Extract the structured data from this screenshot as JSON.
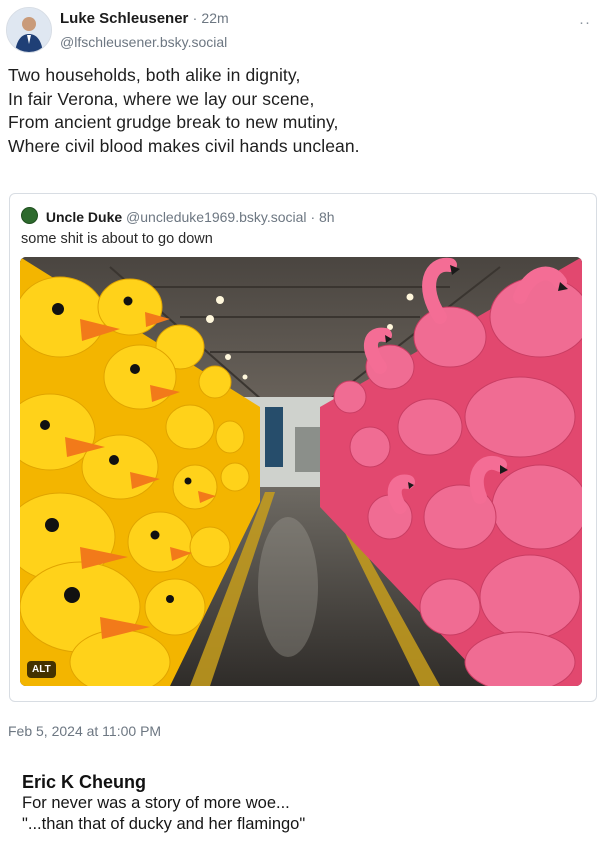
{
  "post": {
    "author_name": "Luke Schleusener",
    "separator": "·",
    "time_ago": "22m",
    "handle": "@lfschleusener.bsky.social",
    "more_label": "··",
    "lines": [
      "Two households, both alike in dignity,",
      "In fair Verona, where we lay our scene,",
      "From ancient grudge break to new mutiny,",
      "Where civil blood makes civil hands unclean."
    ]
  },
  "quote": {
    "author_name": "Uncle Duke",
    "handle": "@uncleduke1969.bsky.social",
    "separator": "·",
    "time_ago": "8h",
    "text": "some shit is about to go down",
    "image_alt_badge": "ALT"
  },
  "timestamp": "Feb 5, 2024 at 11:00 PM",
  "reply": {
    "author_name": "Eric K Cheung",
    "lines": [
      "For never was a story of more woe...",
      "\"...than that of ducky and her flamingo\""
    ]
  },
  "colors": {
    "secondary_text": "#6d7782",
    "duck_yellow": "#f7c200",
    "duck_beak": "#f07a1c",
    "flamingo_pink": "#ec5a84"
  }
}
